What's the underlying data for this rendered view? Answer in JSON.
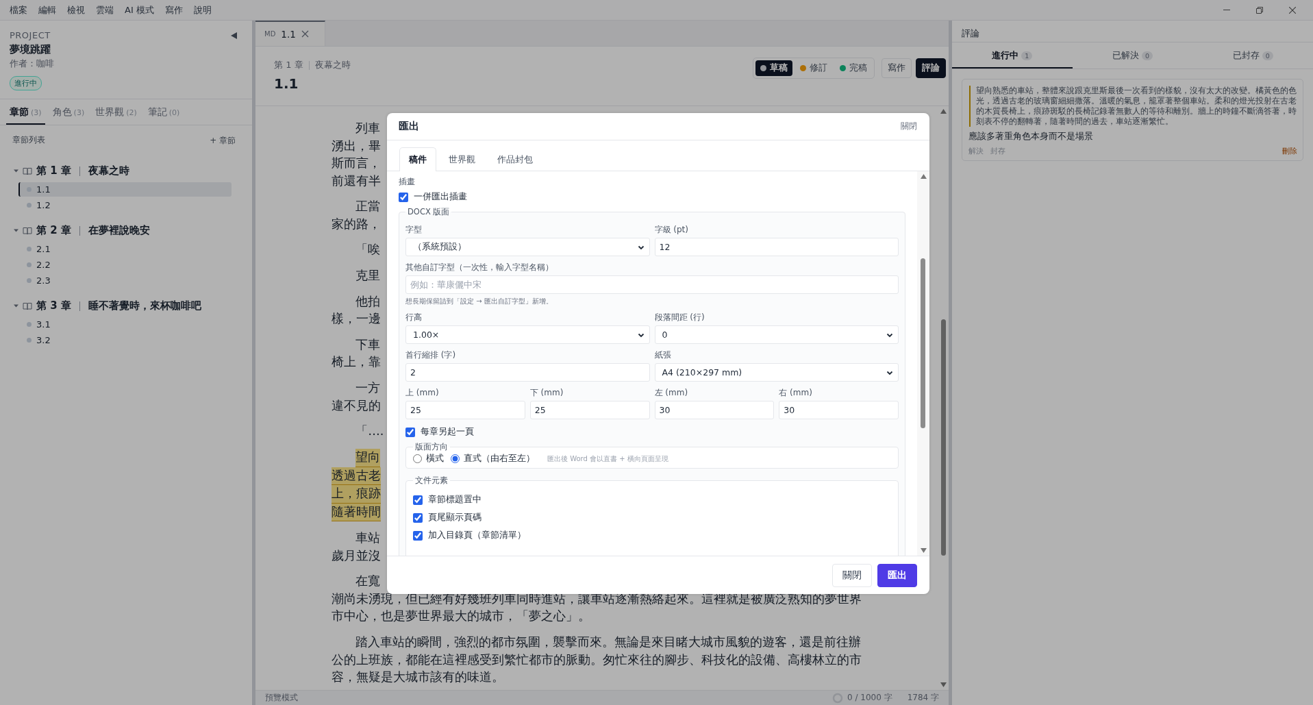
{
  "menu": [
    "檔案",
    "編輯",
    "檢視",
    "雲端",
    "AI 模式",
    "寫作",
    "說明"
  ],
  "sidebar": {
    "section_label": "PROJECT",
    "project_title": "夢境跳躍",
    "author": "作者：咖啡",
    "status_badge": "進行中",
    "tabs": [
      {
        "label": "章節",
        "count": "(3)",
        "selected": true
      },
      {
        "label": "角色",
        "count": "(3)",
        "selected": false
      },
      {
        "label": "世界觀",
        "count": "(2)",
        "selected": false
      },
      {
        "label": "筆記",
        "count": "(0)",
        "selected": false
      }
    ],
    "list_title": "章節列表",
    "add_button": "+ 章節",
    "chapters": [
      {
        "number": "第 1 章",
        "title": "夜幕之時",
        "expanded": true,
        "children": [
          {
            "label": "1.1",
            "selected": true
          },
          {
            "label": "1.2",
            "selected": false
          }
        ]
      },
      {
        "number": "第 2 章",
        "title": "在夢裡說晚安",
        "expanded": true,
        "children": [
          {
            "label": "2.1",
            "selected": false
          },
          {
            "label": "2.2",
            "selected": false
          },
          {
            "label": "2.3",
            "selected": false
          }
        ]
      },
      {
        "number": "第 3 章",
        "title": "睡不著覺時，來杯咖啡吧",
        "expanded": true,
        "children": [
          {
            "label": "3.1",
            "selected": false
          },
          {
            "label": "3.2",
            "selected": false
          }
        ]
      }
    ]
  },
  "editor": {
    "tab": {
      "type_badge": "MD",
      "label": "1.1"
    },
    "breadcrumb": {
      "chapter": "第 1 章",
      "title": "夜幕之時"
    },
    "title": "1.1",
    "status_options": [
      {
        "label": "草稿",
        "color": "#929599",
        "selected": true
      },
      {
        "label": "修訂",
        "color": "#ac6f08",
        "selected": false
      },
      {
        "label": "完稿",
        "color": "#0b825a",
        "selected": false
      }
    ],
    "modes": [
      {
        "label": "寫作",
        "selected": false
      },
      {
        "label": "評論",
        "selected": true
      }
    ],
    "paragraphs": [
      {
        "highlighted": false,
        "lines": [
          "列車",
          "湧出，畢",
          "斯而言，",
          "前還有半"
        ]
      },
      {
        "highlighted": false,
        "lines": [
          "正當",
          "家的路，"
        ]
      },
      {
        "highlighted": false,
        "lines": [
          "「唉"
        ]
      },
      {
        "highlighted": false,
        "lines": [
          "克里"
        ]
      },
      {
        "highlighted": false,
        "lines": [
          "他拍",
          "樣，一邊"
        ]
      },
      {
        "highlighted": false,
        "lines": [
          "下車",
          "椅上，靠"
        ]
      },
      {
        "highlighted": false,
        "lines": [
          "一方",
          "違不見的"
        ]
      },
      {
        "highlighted": false,
        "lines": [
          "「…."
        ]
      },
      {
        "highlighted": true,
        "lines": [
          "望向",
          "透過古老",
          "上，痕跡",
          "隨著時間"
        ]
      },
      {
        "highlighted": false,
        "lines": [
          "車站",
          "歲月並沒"
        ]
      },
      {
        "highlighted": false,
        "lines": [
          "在寬",
          "潮尚未湧現，但已經有好幾班列車同時進站，讓車站逐漸熱絡起來。這裡就是被廣泛熟知的夢世界",
          "市中心，也是夢世界最大的城市，「夢之心」。"
        ]
      },
      {
        "highlighted": false,
        "lines": [
          "踏入車站的瞬間，強烈的都市氛圍，襲擊而來。無論是來目睹大城市風貌的遊客，還是前往辦",
          "公的上班族，都能在這裡感受到繁忙都市的脈動。匆忙來往的腳步、科技化的設備、高樓林立的市",
          "容，無疑是大城市該有的味道。"
        ]
      }
    ],
    "status_bar": {
      "mode": "預覽模式",
      "goal": "0 / 1000 字",
      "count": "1784 字"
    }
  },
  "comments": {
    "title": "評論",
    "tabs": [
      {
        "label": "進行中",
        "count": "1",
        "selected": true
      },
      {
        "label": "已解決",
        "count": "0",
        "selected": false
      },
      {
        "label": "已封存",
        "count": "0",
        "selected": false
      }
    ],
    "items": [
      {
        "quote": "望向熟悉的車站，整體來說跟克里斯最後一次看到的樣貌，沒有太大的改變。橘黃色的色光，透過古老的玻璃窗細細撒落。溫暖的氣息，籠罩著整個車站。柔和的燈光投射在古老的木質長椅上，痕跡斑駁的長椅記錄著無數人的等待和離別。牆上的時鐘不斷滴答著，時刻表不停的翻轉著，隨著時間的過去，車站逐漸繁忙。",
        "text": "應該多著重角色本身而不是場景",
        "actions": [
          "解決",
          "封存"
        ],
        "delete": "刪除"
      }
    ]
  },
  "export_dialog": {
    "title": "匯出",
    "close_link": "關閉",
    "tabs": [
      {
        "label": "稿件",
        "selected": true
      },
      {
        "label": "世界觀",
        "selected": false
      },
      {
        "label": "作品封包",
        "selected": false
      }
    ],
    "illustration": {
      "label": "插畫",
      "option": {
        "label": "一併匯出插畫",
        "checked": true
      }
    },
    "docx": {
      "legend": "DOCX 版面",
      "rows": [
        [
          {
            "label": "字型",
            "kind": "select",
            "value": "（系統預設）"
          },
          {
            "label": "字級 (pt)",
            "kind": "input",
            "value": "12"
          }
        ],
        [
          {
            "label": "其他自訂字型（一次性，輸入字型名稱）",
            "kind": "input",
            "placeholder": "例如：華康儷中宋",
            "hint": "想長期保留請到「設定 → 匯出自訂字型」新增。"
          }
        ],
        [
          {
            "label": "行高",
            "kind": "select",
            "value": "1.00×"
          },
          {
            "label": "段落間距 (行)",
            "kind": "select",
            "value": "0"
          }
        ],
        [
          {
            "label": "首行縮排 (字)",
            "kind": "input",
            "value": "2"
          },
          {
            "label": "紙張",
            "kind": "select",
            "value": "A4 (210×297 mm)"
          }
        ],
        [
          {
            "label": "上 (mm)",
            "kind": "input",
            "value": "25"
          },
          {
            "label": "下 (mm)",
            "kind": "input",
            "value": "25"
          },
          {
            "label": "左 (mm)",
            "kind": "input",
            "value": "30"
          },
          {
            "label": "右 (mm)",
            "kind": "input",
            "value": "30"
          }
        ]
      ],
      "new_page": {
        "label": "每章另起一頁",
        "checked": true
      },
      "orientation": {
        "legend": "版面方向",
        "options": [
          {
            "label": "橫式",
            "selected": false
          },
          {
            "label": "直式（由右至左）",
            "selected": true
          }
        ],
        "hint": "匯出後 Word 會以直書 + 橫向頁面呈現"
      },
      "elements": {
        "legend": "文件元素",
        "items": [
          {
            "label": "章節標題置中",
            "checked": true
          },
          {
            "label": "頁尾顯示頁碼",
            "checked": true
          },
          {
            "label": "加入目錄頁（章節清單）",
            "checked": true
          }
        ]
      }
    },
    "buttons": [
      {
        "label": "關閉",
        "kind": "secondary"
      },
      {
        "label": "匯出",
        "kind": "primary"
      }
    ]
  }
}
